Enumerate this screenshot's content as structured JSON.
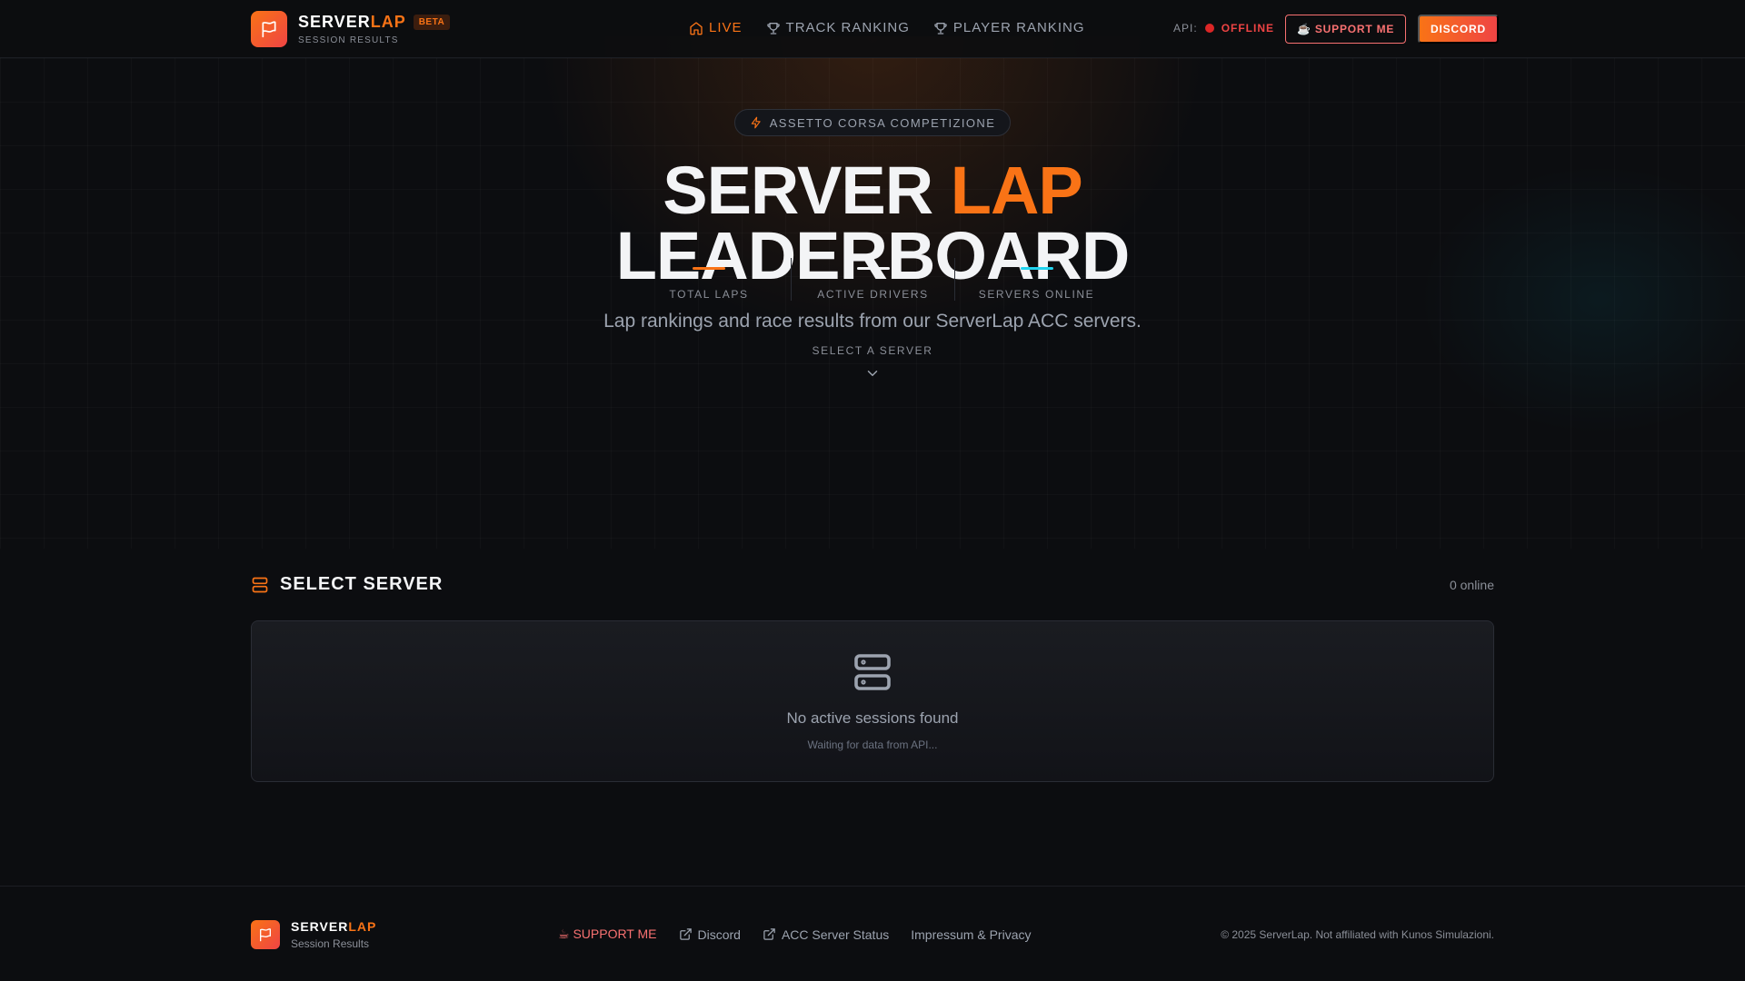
{
  "header": {
    "brand_main": "SERVER",
    "brand_accent": "LAP",
    "badge": "BETA",
    "subtitle": "SESSION RESULTS",
    "nav": [
      {
        "label": "LIVE",
        "icon": "home-icon",
        "active": true
      },
      {
        "label": "TRACK RANKING",
        "icon": "trophy-icon",
        "active": false
      },
      {
        "label": "PLAYER RANKING",
        "icon": "trophy-icon",
        "active": false
      }
    ],
    "api_label": "API:",
    "api_status": "OFFLINE",
    "support_label": "☕ SUPPORT ME",
    "discord_label": "DISCORD"
  },
  "hero": {
    "pill": "ASSETTO CORSA COMPETIZIONE",
    "title_main": "SERVER",
    "title_accent": "LAP",
    "title_line2": "LEADERBOARD",
    "subtitle": "Lap rankings and race results from our ServerLap ACC servers.",
    "stats": [
      {
        "label": "TOTAL LAPS",
        "color": "#f97316"
      },
      {
        "label": "ACTIVE DRIVERS",
        "color": "#f3f4f6"
      },
      {
        "label": "SERVERS ONLINE",
        "color": "#22d3ee"
      }
    ],
    "select_hint": "SELECT A SERVER"
  },
  "servers": {
    "title": "SELECT SERVER",
    "online": "0 online",
    "empty_title": "No active sessions found",
    "empty_sub": "Waiting for data from API..."
  },
  "footer": {
    "brand_main": "SERVER",
    "brand_accent": "LAP",
    "subtitle": "Session Results",
    "links": [
      {
        "label": "☕ SUPPORT ME"
      },
      {
        "label": "Discord",
        "icon": "external-link-icon"
      },
      {
        "label": "ACC Server Status",
        "icon": "external-link-icon"
      },
      {
        "label": "Impressum & Privacy"
      }
    ],
    "copyright": "© 2025 ServerLap. Not affiliated with Kunos Simulazioni."
  },
  "colors": {
    "accent": "#f97316",
    "danger": "#ef4444",
    "cyan": "#22d3ee",
    "background": "#0c0d10"
  }
}
